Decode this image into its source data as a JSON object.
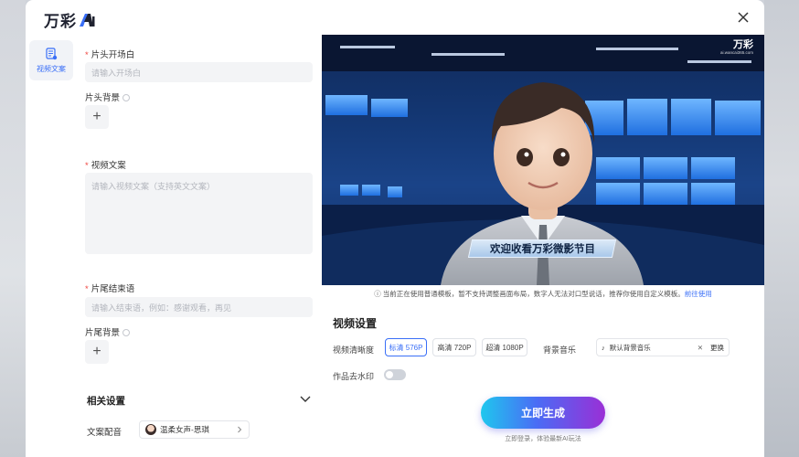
{
  "brand": {
    "name": "万彩"
  },
  "sidebar": {
    "items": [
      {
        "label": "视频文案",
        "icon": "script-icon",
        "active": true
      }
    ]
  },
  "form": {
    "opening": {
      "label": "片头开场白",
      "placeholder": "请输入开场白"
    },
    "opening_bg": {
      "label": "片头背景",
      "add": "+"
    },
    "script": {
      "label": "视频文案",
      "placeholder": "请输入视频文案（支持英文文案）"
    },
    "closing": {
      "label": "片尾结束语",
      "placeholder": "请输入结束语，例如：感谢观看，再见"
    },
    "closing_bg": {
      "label": "片尾背景",
      "add": "+"
    },
    "related": {
      "title": "相关设置"
    },
    "voice": {
      "label": "文案配音",
      "value": "温柔女声-思琪"
    }
  },
  "preview": {
    "watermark": "万彩",
    "watermark_sub": "ai.wancai365.com",
    "caption": "欢迎收看万彩微影节目",
    "notice": "当前正在使用普通模板，暂不支持调整画面布局，数字人无法对口型说话，推荐你使用自定义模板。",
    "notice_link": "前往使用"
  },
  "video_settings": {
    "title": "视频设置",
    "quality_label": "视频清晰度",
    "quality_options": [
      "标清 576P",
      "高清 720P",
      "超清 1080P"
    ],
    "quality_selected": "标清 576P",
    "music_label": "背景音乐",
    "music_value": "默认背景音乐",
    "music_swap": "更换",
    "watermark_label": "作品去水印",
    "watermark_removed": false
  },
  "actions": {
    "generate": "立即生成",
    "hint": "立即登录，体验最新AI玩法"
  },
  "colors": {
    "accent": "#3a6ff7",
    "required": "#f0443f"
  }
}
